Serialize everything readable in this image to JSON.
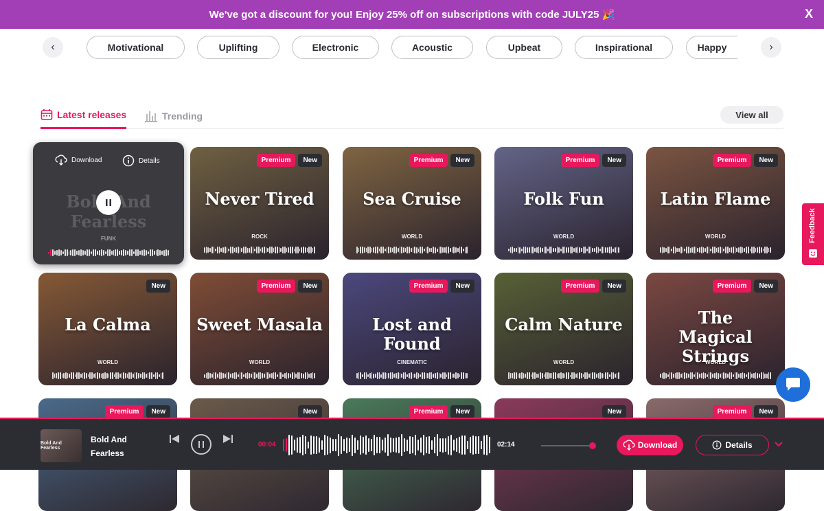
{
  "promo": {
    "text": "We've got a discount for you! Enjoy 25% off on subscriptions with code JULY25 🎉",
    "close": "X"
  },
  "genres": [
    "Motivational",
    "Uplifting",
    "Electronic",
    "Acoustic",
    "Upbeat",
    "Inspirational",
    "Happy"
  ],
  "tabs": {
    "latest": "Latest releases",
    "trending": "Trending",
    "view_all": "View all"
  },
  "hover_card": {
    "download": "Download",
    "details": "Details",
    "title": "Bold And Fearless",
    "genre": "FUNK"
  },
  "badges": {
    "premium": "Premium",
    "new": "New"
  },
  "cards": [
    {
      "title": "Never Tired",
      "genre": "ROCK",
      "premium": true,
      "bg": "#8a7a4a"
    },
    {
      "title": "Sea Cruise",
      "genre": "WORLD",
      "premium": true,
      "bg": "#a0804a"
    },
    {
      "title": "Folk Fun",
      "genre": "WORLD",
      "premium": true,
      "bg": "#7a7fa8"
    },
    {
      "title": "Latin Flame",
      "genre": "WORLD",
      "premium": true,
      "bg": "#9a6a4a"
    },
    {
      "title": "La Calma",
      "genre": "WORLD",
      "premium": false,
      "bg": "#a8703a"
    },
    {
      "title": "Sweet Masala",
      "genre": "WORLD",
      "premium": true,
      "bg": "#a0603a"
    },
    {
      "title": "Lost and Found",
      "genre": "CINEMATIC",
      "premium": true,
      "bg": "#5a5a9a"
    },
    {
      "title": "Calm Nature",
      "genre": "WORLD",
      "premium": true,
      "bg": "#6a7a3a"
    },
    {
      "title": "The Magical Strings",
      "genre": "WORLD",
      "premium": true,
      "bg": "#9a5a4a"
    }
  ],
  "bottom_cards": [
    {
      "premium": true,
      "bg": "#4a6a8a"
    },
    {
      "premium": false,
      "bg": "#6a5a4a"
    },
    {
      "premium": true,
      "bg": "#4a7a5a"
    },
    {
      "premium": false,
      "bg": "#8a3a5a"
    },
    {
      "premium": true,
      "bg": "#8a6a6a"
    }
  ],
  "feedback": "Feedback",
  "player": {
    "art_text": "Bold And Fearless",
    "title": "Bold And Fearless",
    "current_time": "00:04",
    "duration": "02:14",
    "progress": 0.03,
    "volume": 1.0,
    "download": "Download",
    "details": "Details"
  },
  "colors": {
    "accent": "#e8185c",
    "promo": "#a33fb6",
    "player_bg": "#2b2d33",
    "chat": "#1e6fd9"
  }
}
